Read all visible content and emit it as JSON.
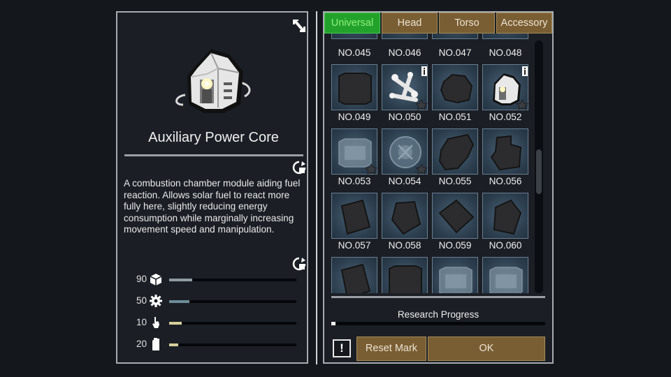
{
  "item": {
    "title": "Auxiliary Power Core",
    "description": "A combustion chamber module aiding fuel reaction. Allows solar fuel to react more fully here, slightly reducing energy consumption while marginally increasing movement speed and manipulation."
  },
  "stats": [
    {
      "value": "90",
      "icon": "cube-icon",
      "level": 0.18,
      "color": "#8f9aa3"
    },
    {
      "value": "50",
      "icon": "gear-icon",
      "level": 0.16,
      "color": "#6e8c9a"
    },
    {
      "value": "10",
      "icon": "hand-icon",
      "level": 0.1,
      "color": "#d6cf9c"
    },
    {
      "value": "20",
      "icon": "fuel-can-icon",
      "level": 0.07,
      "color": "#d6cf9c"
    }
  ],
  "tabs": [
    {
      "label": "Universal",
      "active": true
    },
    {
      "label": "Head",
      "active": false
    },
    {
      "label": "Torso",
      "active": false
    },
    {
      "label": "Accessory",
      "active": false
    }
  ],
  "grid": {
    "top_labels": [
      "NO.045",
      "NO.046",
      "NO.047",
      "NO.048"
    ],
    "rows": [
      [
        {
          "label": "NO.049",
          "shape": "silhouette-wide",
          "info": false,
          "star": false
        },
        {
          "label": "NO.050",
          "shape": "bones",
          "info": true,
          "star": true
        },
        {
          "label": "NO.051",
          "shape": "silhouette-blob",
          "info": false,
          "star": false
        },
        {
          "label": "NO.052",
          "shape": "power-core",
          "info": true,
          "star": true
        }
      ],
      [
        {
          "label": "NO.053",
          "shape": "faded-box",
          "info": false,
          "star": true
        },
        {
          "label": "NO.054",
          "shape": "faded-disc",
          "info": false,
          "star": true
        },
        {
          "label": "NO.055",
          "shape": "silhouette-rock",
          "info": false,
          "star": false
        },
        {
          "label": "NO.056",
          "shape": "silhouette-tall",
          "info": false,
          "star": false
        }
      ],
      [
        {
          "label": "NO.057",
          "shape": "silhouette-card",
          "info": false,
          "star": false
        },
        {
          "label": "NO.058",
          "shape": "silhouette-card2",
          "info": false,
          "star": false
        },
        {
          "label": "NO.059",
          "shape": "silhouette-card3",
          "info": false,
          "star": false
        },
        {
          "label": "NO.060",
          "shape": "silhouette-card4",
          "info": false,
          "star": false
        }
      ],
      [
        {
          "label": "",
          "shape": "silhouette-card",
          "info": false,
          "star": false
        },
        {
          "label": "",
          "shape": "silhouette-wide",
          "info": false,
          "star": false
        },
        {
          "label": "",
          "shape": "faded-box",
          "info": false,
          "star": true
        },
        {
          "label": "",
          "shape": "faded-box",
          "info": false,
          "star": true
        }
      ]
    ]
  },
  "research": {
    "label": "Research Progress",
    "progress": 0.02
  },
  "buttons": {
    "alert_symbol": "!",
    "reset_mark": "Reset Mark",
    "ok": "OK"
  },
  "colors": {
    "tab_active": "#22a22b",
    "tab_inactive": "#7a5e33",
    "button": "#7a5e33",
    "panel_border": "#a7abb0"
  }
}
